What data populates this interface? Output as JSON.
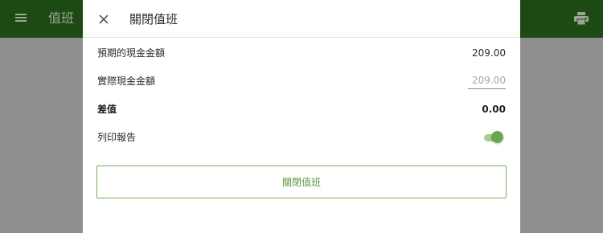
{
  "app_bar": {
    "title": "值班",
    "menu_icon": "menu-icon",
    "print_icon": "printer-icon",
    "color": "#1c4a12"
  },
  "dialog": {
    "title": "關閉值班",
    "close_icon": "close-icon",
    "expected_cash": {
      "label": "預期的現金金額",
      "value": "209.00"
    },
    "actual_cash": {
      "label": "實際現金金額",
      "value": "",
      "placeholder": "209.00"
    },
    "difference": {
      "label": "差值",
      "value": "0.00"
    },
    "print_report": {
      "label": "列印報告",
      "enabled": true
    },
    "close_shift_button": "關閉值班",
    "accent_color": "#6aa84f"
  }
}
